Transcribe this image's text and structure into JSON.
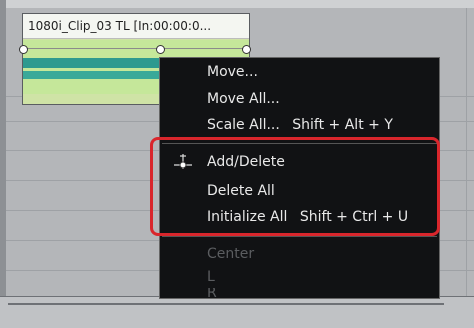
{
  "clip": {
    "title": "1080i_Clip_03  TL [In:00:00:0..."
  },
  "menu": {
    "move": "Move...",
    "move_all": "Move All...",
    "scale_all": "Scale All...",
    "scale_all_shortcut": "Shift + Alt + Y",
    "add_delete": "Add/Delete",
    "delete_all": "Delete All",
    "initialize_all": "Initialize All",
    "initialize_all_shortcut": "Shift + Ctrl + U",
    "center": "Center",
    "left": "L",
    "right": "R"
  },
  "icons": {
    "add_delete": "add-delete-keyframe-icon"
  },
  "colors": {
    "highlight": "#d9262c",
    "menu_bg": "#111214"
  }
}
